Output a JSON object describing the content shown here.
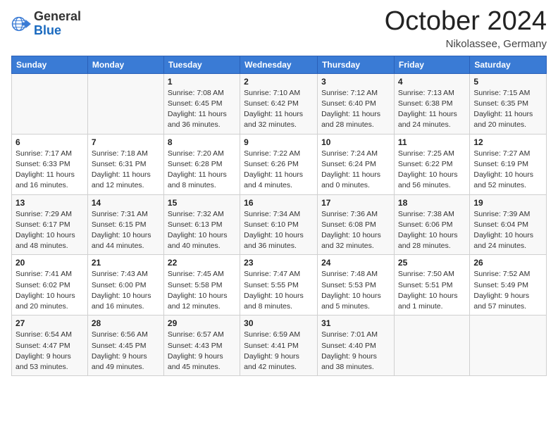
{
  "header": {
    "logo_general": "General",
    "logo_blue": "Blue",
    "month_title": "October 2024",
    "subtitle": "Nikolassee, Germany"
  },
  "days_of_week": [
    "Sunday",
    "Monday",
    "Tuesday",
    "Wednesday",
    "Thursday",
    "Friday",
    "Saturday"
  ],
  "weeks": [
    [
      {
        "day": "",
        "info": ""
      },
      {
        "day": "",
        "info": ""
      },
      {
        "day": "1",
        "info": "Sunrise: 7:08 AM\nSunset: 6:45 PM\nDaylight: 11 hours and 36 minutes."
      },
      {
        "day": "2",
        "info": "Sunrise: 7:10 AM\nSunset: 6:42 PM\nDaylight: 11 hours and 32 minutes."
      },
      {
        "day": "3",
        "info": "Sunrise: 7:12 AM\nSunset: 6:40 PM\nDaylight: 11 hours and 28 minutes."
      },
      {
        "day": "4",
        "info": "Sunrise: 7:13 AM\nSunset: 6:38 PM\nDaylight: 11 hours and 24 minutes."
      },
      {
        "day": "5",
        "info": "Sunrise: 7:15 AM\nSunset: 6:35 PM\nDaylight: 11 hours and 20 minutes."
      }
    ],
    [
      {
        "day": "6",
        "info": "Sunrise: 7:17 AM\nSunset: 6:33 PM\nDaylight: 11 hours and 16 minutes."
      },
      {
        "day": "7",
        "info": "Sunrise: 7:18 AM\nSunset: 6:31 PM\nDaylight: 11 hours and 12 minutes."
      },
      {
        "day": "8",
        "info": "Sunrise: 7:20 AM\nSunset: 6:28 PM\nDaylight: 11 hours and 8 minutes."
      },
      {
        "day": "9",
        "info": "Sunrise: 7:22 AM\nSunset: 6:26 PM\nDaylight: 11 hours and 4 minutes."
      },
      {
        "day": "10",
        "info": "Sunrise: 7:24 AM\nSunset: 6:24 PM\nDaylight: 11 hours and 0 minutes."
      },
      {
        "day": "11",
        "info": "Sunrise: 7:25 AM\nSunset: 6:22 PM\nDaylight: 10 hours and 56 minutes."
      },
      {
        "day": "12",
        "info": "Sunrise: 7:27 AM\nSunset: 6:19 PM\nDaylight: 10 hours and 52 minutes."
      }
    ],
    [
      {
        "day": "13",
        "info": "Sunrise: 7:29 AM\nSunset: 6:17 PM\nDaylight: 10 hours and 48 minutes."
      },
      {
        "day": "14",
        "info": "Sunrise: 7:31 AM\nSunset: 6:15 PM\nDaylight: 10 hours and 44 minutes."
      },
      {
        "day": "15",
        "info": "Sunrise: 7:32 AM\nSunset: 6:13 PM\nDaylight: 10 hours and 40 minutes."
      },
      {
        "day": "16",
        "info": "Sunrise: 7:34 AM\nSunset: 6:10 PM\nDaylight: 10 hours and 36 minutes."
      },
      {
        "day": "17",
        "info": "Sunrise: 7:36 AM\nSunset: 6:08 PM\nDaylight: 10 hours and 32 minutes."
      },
      {
        "day": "18",
        "info": "Sunrise: 7:38 AM\nSunset: 6:06 PM\nDaylight: 10 hours and 28 minutes."
      },
      {
        "day": "19",
        "info": "Sunrise: 7:39 AM\nSunset: 6:04 PM\nDaylight: 10 hours and 24 minutes."
      }
    ],
    [
      {
        "day": "20",
        "info": "Sunrise: 7:41 AM\nSunset: 6:02 PM\nDaylight: 10 hours and 20 minutes."
      },
      {
        "day": "21",
        "info": "Sunrise: 7:43 AM\nSunset: 6:00 PM\nDaylight: 10 hours and 16 minutes."
      },
      {
        "day": "22",
        "info": "Sunrise: 7:45 AM\nSunset: 5:58 PM\nDaylight: 10 hours and 12 minutes."
      },
      {
        "day": "23",
        "info": "Sunrise: 7:47 AM\nSunset: 5:55 PM\nDaylight: 10 hours and 8 minutes."
      },
      {
        "day": "24",
        "info": "Sunrise: 7:48 AM\nSunset: 5:53 PM\nDaylight: 10 hours and 5 minutes."
      },
      {
        "day": "25",
        "info": "Sunrise: 7:50 AM\nSunset: 5:51 PM\nDaylight: 10 hours and 1 minute."
      },
      {
        "day": "26",
        "info": "Sunrise: 7:52 AM\nSunset: 5:49 PM\nDaylight: 9 hours and 57 minutes."
      }
    ],
    [
      {
        "day": "27",
        "info": "Sunrise: 6:54 AM\nSunset: 4:47 PM\nDaylight: 9 hours and 53 minutes."
      },
      {
        "day": "28",
        "info": "Sunrise: 6:56 AM\nSunset: 4:45 PM\nDaylight: 9 hours and 49 minutes."
      },
      {
        "day": "29",
        "info": "Sunrise: 6:57 AM\nSunset: 4:43 PM\nDaylight: 9 hours and 45 minutes."
      },
      {
        "day": "30",
        "info": "Sunrise: 6:59 AM\nSunset: 4:41 PM\nDaylight: 9 hours and 42 minutes."
      },
      {
        "day": "31",
        "info": "Sunrise: 7:01 AM\nSunset: 4:40 PM\nDaylight: 9 hours and 38 minutes."
      },
      {
        "day": "",
        "info": ""
      },
      {
        "day": "",
        "info": ""
      }
    ]
  ]
}
